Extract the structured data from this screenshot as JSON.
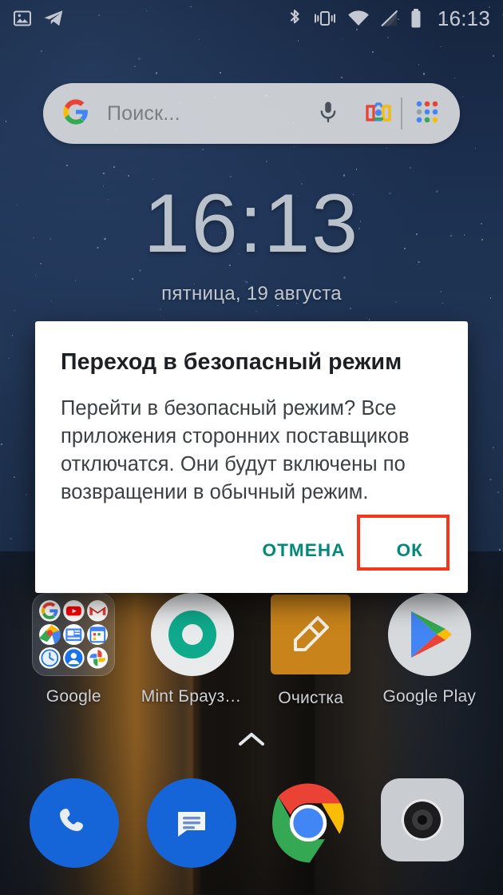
{
  "statusbar": {
    "time": "16:13",
    "left_icons": [
      {
        "name": "screenshot-icon",
        "label": "screenshot"
      },
      {
        "name": "telegram-icon",
        "label": "telegram"
      }
    ],
    "right_icons": [
      {
        "name": "bluetooth-icon",
        "label": "bluetooth"
      },
      {
        "name": "vibrate-icon",
        "label": "vibrate"
      },
      {
        "name": "wifi-icon",
        "label": "wifi"
      },
      {
        "name": "no-sim-icon",
        "label": "no-sim"
      },
      {
        "name": "battery-icon",
        "label": "battery"
      }
    ]
  },
  "search": {
    "placeholder": "Поиск...",
    "google_logo": "google-g-icon",
    "mic_icon": "microphone-icon",
    "lens_icon": "google-lens-camera-icon",
    "apps_icon": "app-grid-icon"
  },
  "clock_widget": {
    "time": "16:13",
    "date": "пятница, 19 августа"
  },
  "home_apps": [
    {
      "label": "Google",
      "icon": "google-folder-icon",
      "folder_items": [
        "google-icon",
        "youtube-icon",
        "gmail-icon",
        "maps-icon",
        "news-icon",
        "calendar-icon",
        "clock-icon",
        "contacts-icon",
        "photos-icon"
      ]
    },
    {
      "label": "Mint Браузе..",
      "icon": "mint-browser-icon"
    },
    {
      "label": "Очистка",
      "icon": "cleaner-brush-icon"
    },
    {
      "label": "Google Play",
      "icon": "google-play-icon"
    }
  ],
  "drawer_handle": {
    "icon": "chevron-up-icon"
  },
  "dock": [
    {
      "label": "Телефон",
      "icon": "phone-icon"
    },
    {
      "label": "Сообщения",
      "icon": "messages-icon"
    },
    {
      "label": "Chrome",
      "icon": "chrome-icon"
    },
    {
      "label": "Камера",
      "icon": "camera-icon"
    }
  ],
  "dialog": {
    "title": "Переход в безопасный режим",
    "body": "Перейти в безопасный режим? Все приложения сторонних поставщиков отключатся. Они будут включены по возвращении в обычный режим.",
    "cancel_label": "ОТМЕНА",
    "ok_label": "ОК"
  },
  "annotation": {
    "highlight_target": "ОК",
    "highlight_color": "#f4371a"
  },
  "colors": {
    "accent_teal": "#00897b",
    "dialog_bg": "#ffffff",
    "wallpaper_sky": "#1d3050",
    "highlight_red": "#f4371a"
  }
}
